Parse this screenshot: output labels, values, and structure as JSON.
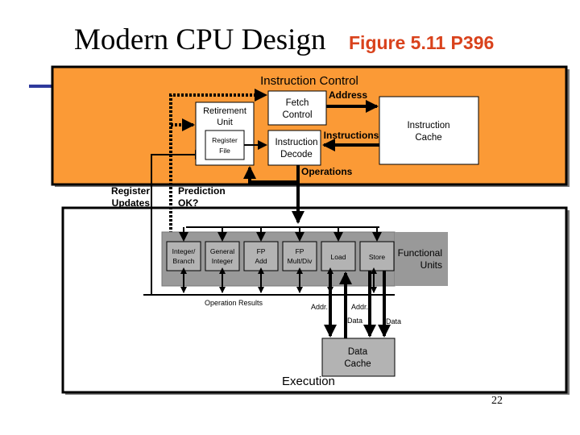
{
  "slide": {
    "title": "Modern CPU Design",
    "figure_ref": "Figure 5.11  P396",
    "page_number": "22"
  },
  "colors": {
    "instruction_control_fill": "#fb9a36",
    "functional_units_fill": "#999999",
    "unit_fill": "#b3b3b3",
    "title_accent": "#d9421c",
    "side_bar": "#2e3a9c"
  },
  "instruction_control": {
    "label": "Instruction Control",
    "retirement_unit": [
      "Retirement",
      "Unit"
    ],
    "register_file": [
      "Register",
      "File"
    ],
    "fetch_control": [
      "Fetch",
      "Control"
    ],
    "instruction_decode": [
      "Instruction",
      "Decode"
    ],
    "instruction_cache": [
      "Instruction",
      "Cache"
    ],
    "address_label": "Address",
    "instructions_label": "Instructions",
    "operations_label": "Operations"
  },
  "between": {
    "register_updates": [
      "Register",
      "Updates"
    ],
    "prediction_ok": [
      "Prediction",
      "OK?"
    ]
  },
  "execution": {
    "label": "Execution",
    "functional_units_label": [
      "Functional",
      "Units"
    ],
    "units": [
      [
        "Integer/",
        "Branch"
      ],
      [
        "General",
        "Integer"
      ],
      [
        "FP",
        "Add"
      ],
      [
        "FP",
        "Mult/Div"
      ],
      [
        "Load"
      ],
      [
        "Store"
      ]
    ],
    "operation_results": "Operation Results",
    "load_addr": "Addr.",
    "store_addr": "Addr.",
    "load_data": "Data",
    "store_data": "Data",
    "data_cache": [
      "Data",
      "Cache"
    ]
  }
}
